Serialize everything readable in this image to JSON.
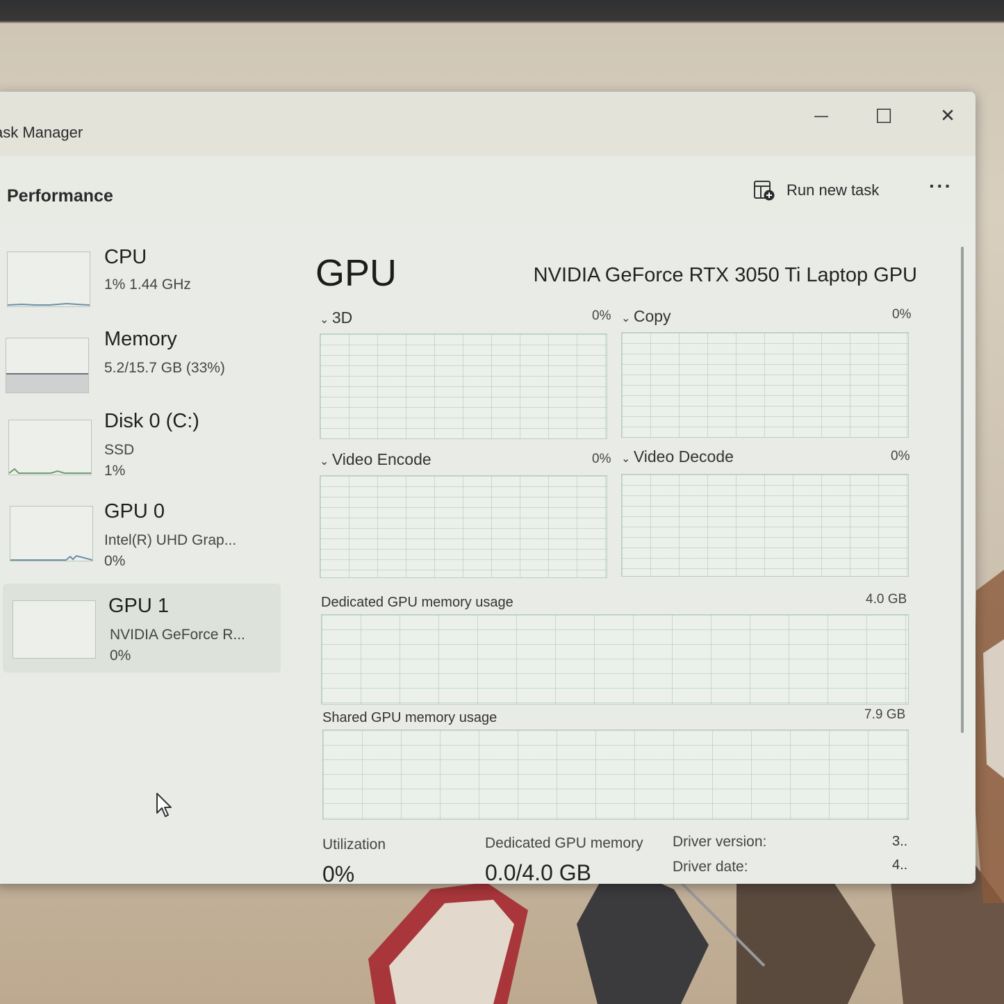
{
  "window": {
    "title": "ask Manager",
    "controls": {
      "minimize": "—",
      "maximize": "☐",
      "close": "✕"
    }
  },
  "header": {
    "title": "Performance",
    "run_task_label": "Run new task",
    "more_label": "···"
  },
  "sidebar": {
    "items": [
      {
        "name": "CPU",
        "line1": "1%  1.44 GHz",
        "line2": ""
      },
      {
        "name": "Memory",
        "line1": "5.2/15.7 GB (33%)",
        "line2": ""
      },
      {
        "name": "Disk 0 (C:)",
        "line1": "SSD",
        "line2": "1%"
      },
      {
        "name": "GPU 0",
        "line1": "Intel(R) UHD Grap...",
        "line2": "0%"
      },
      {
        "name": "GPU 1",
        "line1": "NVIDIA GeForce R...",
        "line2": "0%"
      }
    ],
    "selected_index": 4,
    "memory_usage_fraction": 0.33
  },
  "main": {
    "title": "GPU",
    "model": "NVIDIA GeForce RTX 3050 Ti Laptop GPU",
    "engines": [
      {
        "name": "3D",
        "pct": "0%"
      },
      {
        "name": "Copy",
        "pct": "0%"
      },
      {
        "name": "Video Encode",
        "pct": "0%"
      },
      {
        "name": "Video Decode",
        "pct": "0%"
      }
    ],
    "dedicated_mem": {
      "label": "Dedicated GPU memory usage",
      "max": "4.0 GB"
    },
    "shared_mem": {
      "label": "Shared GPU memory usage",
      "max": "7.9 GB"
    },
    "stats": {
      "utilization_label": "Utilization",
      "utilization_value": "0%",
      "dedicated_label": "Dedicated GPU memory",
      "dedicated_value": "0.0/4.0 GB",
      "driver_version_label": "Driver version:",
      "driver_version_value": "3..",
      "driver_date_label": "Driver date:",
      "driver_date_value": "4.."
    }
  },
  "colors": {
    "window_bg": "#e9ece6",
    "graph_grid": "#8fb0ad",
    "selected_bg": "#dde2da"
  }
}
